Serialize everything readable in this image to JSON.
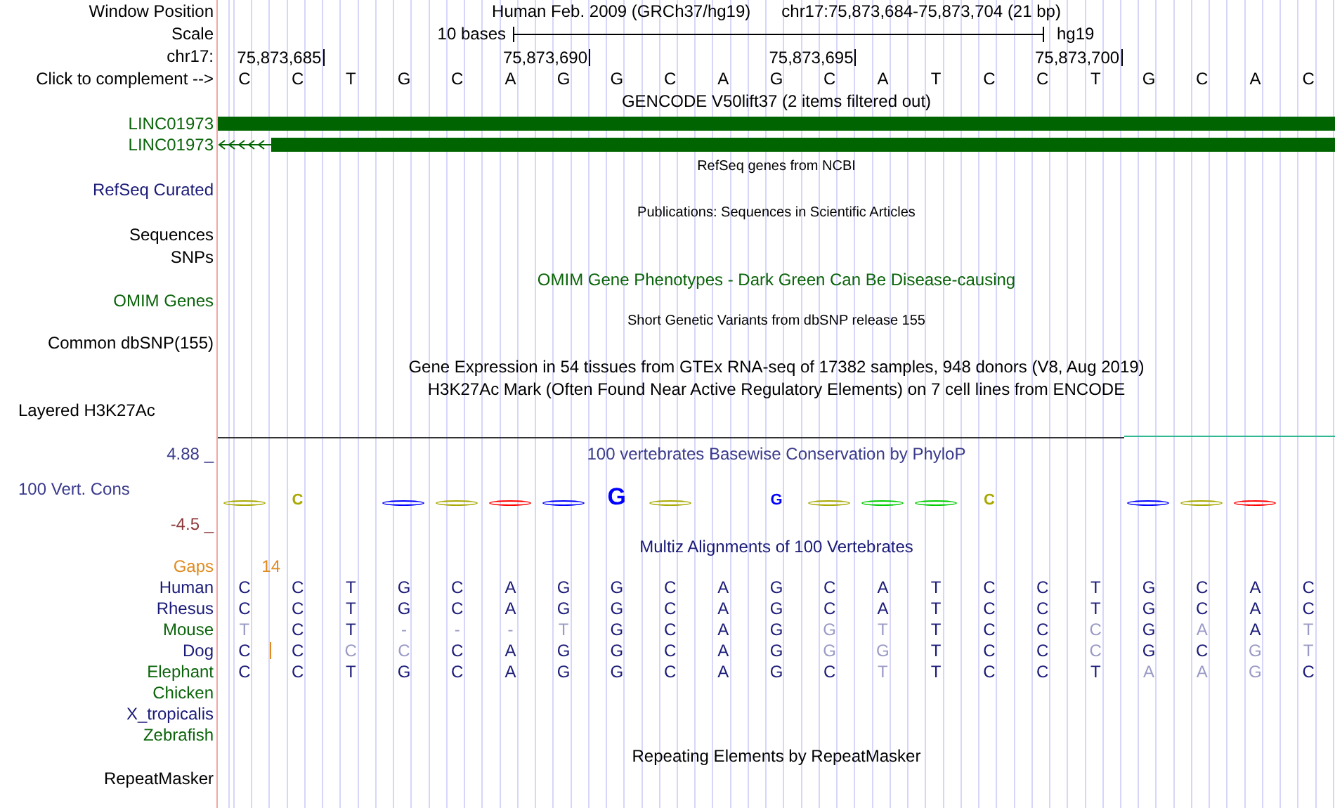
{
  "window_position": {
    "label": "Window Position",
    "assembly": "Human Feb. 2009 (GRCh37/hg19)",
    "position": "chr17:75,873,684-75,873,704 (21 bp)"
  },
  "scale": {
    "label": "Scale",
    "length": "10 bases",
    "assembly": "hg19"
  },
  "ruler": {
    "label": "chr17:",
    "ticks": [
      "75,873,685",
      "75,873,690",
      "75,873,695",
      "75,873,700"
    ]
  },
  "bases": {
    "label": "Click to complement -->",
    "sequence": [
      "C",
      "C",
      "T",
      "G",
      "C",
      "A",
      "G",
      "G",
      "C",
      "A",
      "G",
      "C",
      "A",
      "T",
      "C",
      "C",
      "T",
      "G",
      "C",
      "A",
      "C"
    ]
  },
  "gencode": {
    "title": "GENCODE V50lift37 (2 items filtered out)",
    "items": [
      {
        "name": "LINC01973",
        "arrows": false
      },
      {
        "name": "LINC01973",
        "arrows": true
      }
    ]
  },
  "refseq": {
    "title": "RefSeq genes from NCBI",
    "label": "RefSeq Curated"
  },
  "publications": {
    "title": "Publications: Sequences in Scientific Articles",
    "labels": [
      "Sequences",
      "SNPs"
    ]
  },
  "omim": {
    "title": "OMIM Gene Phenotypes - Dark Green Can Be Disease-causing",
    "label": "OMIM Genes"
  },
  "dbsnp": {
    "title": "Short Genetic Variants from dbSNP release 155",
    "label": "Common dbSNP(155)"
  },
  "gtex": {
    "title": "Gene Expression in 54 tissues from GTEx RNA-seq of 17382 samples, 948 donors (V8, Aug 2019)"
  },
  "h3k27ac": {
    "title": "H3K27Ac Mark (Often Found Near Active Regulatory Elements) on 7 cell lines from ENCODE",
    "label": "Layered H3K27Ac"
  },
  "conservation": {
    "title": "100 vertebrates Basewise Conservation by PhyloP",
    "label": "100 Vert. Cons",
    "max": "4.88 _",
    "min": "-4.5 _",
    "logo": [
      {
        "kind": "flat",
        "color": "#a8a800"
      },
      {
        "kind": "letter",
        "base": "C",
        "color": "#a8a800"
      },
      {
        "kind": "none"
      },
      {
        "kind": "flat",
        "color": "#0000ff"
      },
      {
        "kind": "flat",
        "color": "#a8a800"
      },
      {
        "kind": "flat",
        "color": "#ff0000"
      },
      {
        "kind": "flat",
        "color": "#0000ff"
      },
      {
        "kind": "large",
        "base": "G",
        "color": "#0000ff"
      },
      {
        "kind": "flat",
        "color": "#a8a800"
      },
      {
        "kind": "none"
      },
      {
        "kind": "letter",
        "base": "G",
        "color": "#0000ff"
      },
      {
        "kind": "flat",
        "color": "#a8a800"
      },
      {
        "kind": "flat",
        "color": "#00cc00"
      },
      {
        "kind": "flat",
        "color": "#00cc00"
      },
      {
        "kind": "letter",
        "base": "C",
        "color": "#a8a800"
      },
      {
        "kind": "none"
      },
      {
        "kind": "none"
      },
      {
        "kind": "flat",
        "color": "#0000ff"
      },
      {
        "kind": "flat",
        "color": "#a8a800"
      },
      {
        "kind": "flat",
        "color": "#ff0000"
      },
      {
        "kind": "none"
      }
    ]
  },
  "multiz": {
    "title": "Multiz Alignments of 100 Vertebrates",
    "gaps_label": "Gaps",
    "gaps_count": "14",
    "species": [
      {
        "name": "Human",
        "color": "#1a1a78",
        "insertion": false,
        "bases": [
          "C",
          "C",
          "T",
          "G",
          "C",
          "A",
          "G",
          "G",
          "C",
          "A",
          "G",
          "C",
          "A",
          "T",
          "C",
          "C",
          "T",
          "G",
          "C",
          "A",
          "C"
        ],
        "faded": [
          false,
          false,
          false,
          false,
          false,
          false,
          false,
          false,
          false,
          false,
          false,
          false,
          false,
          false,
          false,
          false,
          false,
          false,
          false,
          false,
          false
        ]
      },
      {
        "name": "Rhesus",
        "color": "#1a1a78",
        "insertion": false,
        "bases": [
          "C",
          "C",
          "T",
          "G",
          "C",
          "A",
          "G",
          "G",
          "C",
          "A",
          "G",
          "C",
          "A",
          "T",
          "C",
          "C",
          "T",
          "G",
          "C",
          "A",
          "C"
        ],
        "faded": [
          false,
          false,
          false,
          false,
          false,
          false,
          false,
          false,
          false,
          false,
          false,
          false,
          false,
          false,
          false,
          false,
          false,
          false,
          false,
          false,
          false
        ]
      },
      {
        "name": "Mouse",
        "color": "#0a640a",
        "insertion": false,
        "bases": [
          "T",
          "C",
          "T",
          "-",
          "-",
          "-",
          "T",
          "G",
          "C",
          "A",
          "G",
          "G",
          "T",
          "T",
          "C",
          "C",
          "C",
          "G",
          "A",
          "A",
          "T"
        ],
        "faded": [
          true,
          false,
          false,
          true,
          true,
          true,
          true,
          false,
          false,
          false,
          false,
          true,
          true,
          false,
          false,
          false,
          true,
          false,
          true,
          false,
          true
        ]
      },
      {
        "name": "Dog",
        "color": "#1a1a78",
        "insertion": true,
        "bases": [
          "C",
          "C",
          "C",
          "C",
          "C",
          "A",
          "G",
          "G",
          "C",
          "A",
          "G",
          "G",
          "G",
          "T",
          "C",
          "C",
          "C",
          "G",
          "C",
          "G",
          "T"
        ],
        "faded": [
          false,
          false,
          true,
          true,
          false,
          false,
          false,
          false,
          false,
          false,
          false,
          true,
          true,
          false,
          false,
          false,
          true,
          false,
          false,
          true,
          true
        ]
      },
      {
        "name": "Elephant",
        "color": "#0a640a",
        "insertion": false,
        "bases": [
          "C",
          "C",
          "T",
          "G",
          "C",
          "A",
          "G",
          "G",
          "C",
          "A",
          "G",
          "C",
          "T",
          "T",
          "C",
          "C",
          "T",
          "A",
          "A",
          "G",
          "C"
        ],
        "faded": [
          false,
          false,
          false,
          false,
          false,
          false,
          false,
          false,
          false,
          false,
          false,
          false,
          true,
          false,
          false,
          false,
          false,
          true,
          true,
          true,
          false
        ]
      },
      {
        "name": "Chicken",
        "color": "#0a640a",
        "insertion": false
      },
      {
        "name": "X_tropicalis",
        "color": "#1a1a78",
        "insertion": false
      },
      {
        "name": "Zebrafish",
        "color": "#0a640a",
        "insertion": false
      }
    ]
  },
  "repeatmasker": {
    "title": "Repeating Elements by RepeatMasker",
    "label": "RepeatMasker"
  }
}
